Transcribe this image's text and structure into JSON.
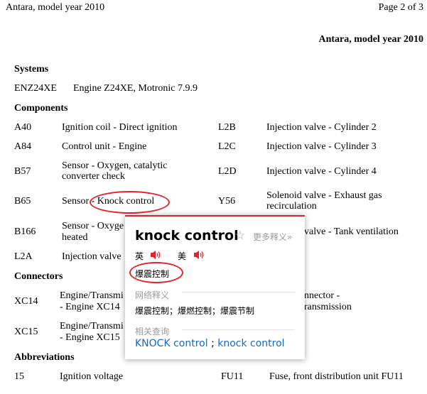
{
  "page": {
    "header_left": "Antara, model year 2010",
    "header_right": "Page 2 of 3",
    "doc_title": "Antara, model year 2010"
  },
  "systems": {
    "heading": "Systems",
    "items": [
      {
        "code": "ENZ24XE",
        "desc": "Engine Z24XE, Motronic 7.9.9"
      }
    ]
  },
  "components": {
    "heading": "Components",
    "left": [
      {
        "code": "A40",
        "desc": "Ignition coil - Direct ignition"
      },
      {
        "code": "A84",
        "desc": "Control unit - Engine"
      },
      {
        "code": "B57",
        "desc": "Sensor - Oxygen, catalytic converter check"
      },
      {
        "code": "B65",
        "desc_prefix": "Sensor ",
        "desc_highlight": "- Knock control"
      },
      {
        "code": "B166",
        "desc": "Sensor - Oxyge",
        "desc2": "heated"
      },
      {
        "code": "L2A",
        "desc": "Injection valve"
      }
    ],
    "right": [
      {
        "code": "L2B",
        "desc": "Injection valve - Cylinder 2"
      },
      {
        "code": "L2C",
        "desc": "Injection valve - Cylinder 3"
      },
      {
        "code": "L2D",
        "desc": "Injection valve - Cylinder 4"
      },
      {
        "code": "Y56",
        "desc": "Solenoid valve - Exhaust gas recirculation"
      },
      {
        "code": "",
        "desc": "valve - Tank ventilation"
      }
    ]
  },
  "connectors": {
    "heading": "Connectors",
    "items": [
      {
        "code": "XC14",
        "line1": "Engine/Transmi",
        "line2": "- Engine XC14",
        "right1": "nnector -",
        "right2": "ransmission"
      },
      {
        "code": "XC15",
        "line1": "Engine/Transmi",
        "line2": "- Engine XC15"
      }
    ]
  },
  "abbreviations": {
    "heading": "Abbreviations",
    "items": [
      {
        "code": "15",
        "desc": "Ignition voltage",
        "code2": "FU11",
        "desc2": "Fuse, front distribution unit FU11"
      }
    ]
  },
  "popup": {
    "word": "knock control",
    "star": "☆",
    "more": "更多释义»",
    "pron_uk": "英",
    "pron_us": "美",
    "translation": "爆震控制",
    "web_heading": "网络释义",
    "web_defs": "爆震控制；爆燃控制；爆震节制",
    "related_heading": "相关查询",
    "related_1": "KNOCK control",
    "related_sep": ";",
    "related_2": "knock control"
  },
  "colors": {
    "highlight_ring": "#e0262c",
    "link": "#1569c7"
  }
}
